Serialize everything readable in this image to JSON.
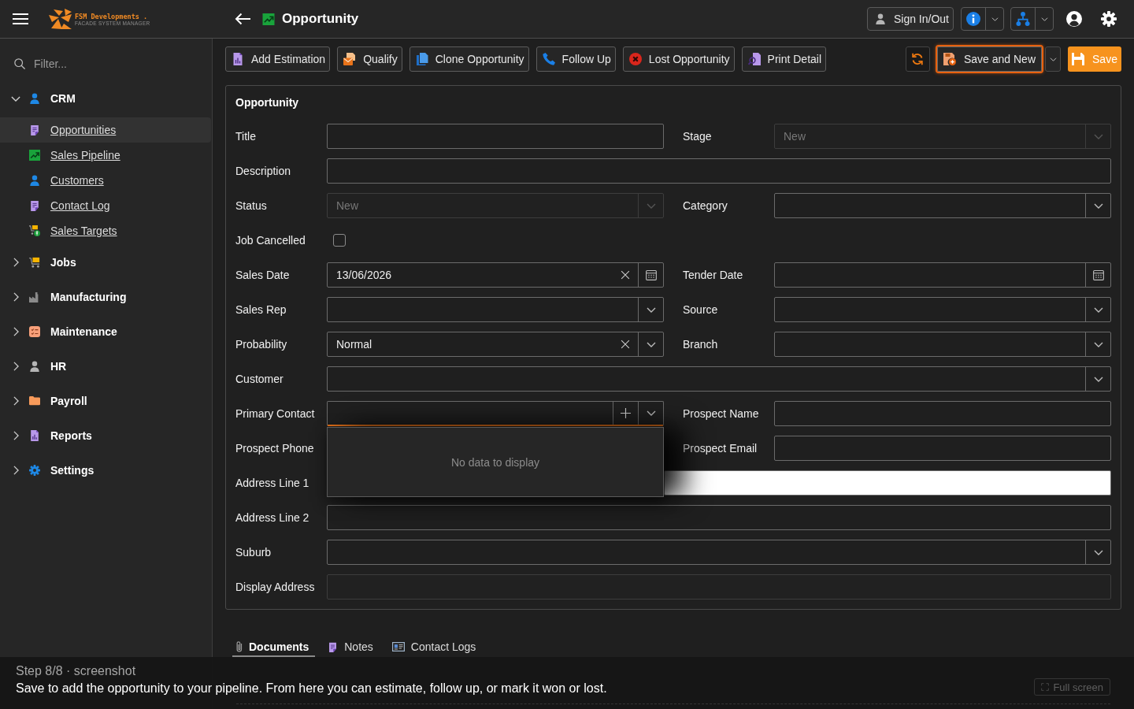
{
  "header": {
    "logo": {
      "name": "FSM Developments .",
      "tagline": "FACADE SYSTEM MANAGER"
    },
    "title": "Opportunity",
    "sign_in": "Sign In/Out"
  },
  "sidebar": {
    "filter": {
      "placeholder": "Filter..."
    },
    "groups": [
      {
        "label": "CRM",
        "expanded": true,
        "children": [
          {
            "label": "Opportunities",
            "selected": true
          },
          {
            "label": "Sales Pipeline",
            "selected": false
          },
          {
            "label": "Customers",
            "selected": false
          },
          {
            "label": "Contact Log",
            "selected": false
          },
          {
            "label": "Sales Targets",
            "selected": false
          }
        ]
      },
      {
        "label": "Jobs",
        "expanded": false
      },
      {
        "label": "Manufacturing",
        "expanded": false
      },
      {
        "label": "Maintenance",
        "expanded": false
      },
      {
        "label": "HR",
        "expanded": false
      },
      {
        "label": "Payroll",
        "expanded": false
      },
      {
        "label": "Reports",
        "expanded": false
      },
      {
        "label": "Settings",
        "expanded": false
      }
    ]
  },
  "toolbar": {
    "actions": [
      "Add Estimation",
      "Qualify",
      "Clone Opportunity",
      "Follow Up",
      "Lost Opportunity",
      "Print Detail"
    ],
    "save_and_new": {
      "label": "Save and New",
      "focused": true
    },
    "save": "Save"
  },
  "form": {
    "title": "Opportunity",
    "rows": [
      {
        "fields": [
          {
            "label": "Title",
            "kind": "text",
            "disabled": false
          },
          {
            "label": "Stage",
            "kind": "select",
            "value": "New",
            "disabled": true
          }
        ]
      },
      {
        "fields": [
          {
            "label": "Description",
            "kind": "text",
            "disabled": false
          }
        ]
      },
      {
        "fields": [
          {
            "label": "Status",
            "kind": "select",
            "value": "New",
            "disabled": true
          },
          {
            "label": "Category",
            "kind": "select",
            "disabled": false
          }
        ]
      },
      {
        "fields": [
          {
            "label": "Job Cancelled",
            "kind": "checkbox",
            "checked": false,
            "disabled": false
          }
        ]
      },
      {
        "fields": [
          {
            "label": "Sales Date",
            "kind": "date",
            "value": "13/06/2026",
            "disabled": false
          },
          {
            "label": "Tender Date",
            "kind": "date",
            "disabled": false
          }
        ]
      },
      {
        "fields": [
          {
            "label": "Sales Rep",
            "kind": "select",
            "disabled": false
          },
          {
            "label": "Source",
            "kind": "select",
            "disabled": false
          }
        ]
      },
      {
        "fields": [
          {
            "label": "Probability",
            "kind": "select",
            "value": "Normal",
            "disabled": false
          },
          {
            "label": "Branch",
            "kind": "select",
            "disabled": false
          }
        ]
      },
      {
        "fields": [
          {
            "label": "Customer",
            "kind": "select",
            "disabled": false
          }
        ]
      },
      {
        "fields": [
          {
            "label": "Primary Contact",
            "kind": "combo",
            "focused": true,
            "disabled": false,
            "popup": {
              "message": "No data to display"
            }
          },
          {
            "label": "Prospect Name",
            "kind": "text",
            "disabled": false
          }
        ]
      },
      {
        "fields": [
          {
            "label": "Prospect Phone",
            "kind": "covered"
          },
          {
            "label": "Prospect Email",
            "kind": "text",
            "disabled": false
          }
        ]
      },
      {
        "fields": [
          {
            "label": "Address Line 1",
            "kind": "text",
            "autofilled": true,
            "disabled": false
          }
        ]
      },
      {
        "fields": [
          {
            "label": "Address Line 2",
            "kind": "text",
            "disabled": false
          }
        ]
      },
      {
        "fields": [
          {
            "label": "Suburb",
            "kind": "select",
            "disabled": false
          }
        ]
      },
      {
        "fields": [
          {
            "label": "Display Address",
            "kind": "text",
            "disabled": true
          }
        ]
      }
    ]
  },
  "detail_tabs": {
    "tabs": [
      {
        "label": "Documents",
        "selected": true
      },
      {
        "label": "Notes",
        "selected": false
      },
      {
        "label": "Contact Logs",
        "selected": false
      }
    ],
    "full_screen_button": "Full screen"
  },
  "caption": {
    "step": "Step 8/8 · screenshot",
    "text": "Save to add the opportunity to your pipeline. From here you can estimate, follow up, or mark it won or lost."
  }
}
